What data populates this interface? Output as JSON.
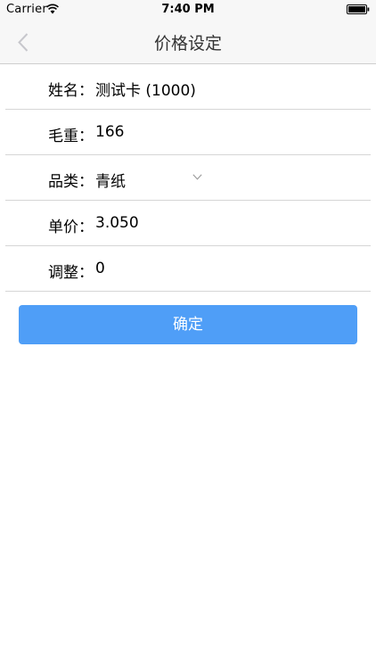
{
  "status_bar": {
    "carrier": "Carrier",
    "time": "7:40 PM",
    "wifi_icon": "wifi-icon",
    "battery_icon": "battery-icon"
  },
  "nav": {
    "title": "价格设定",
    "back_icon": "chevron-left-icon"
  },
  "form": {
    "rows": [
      {
        "label": "姓名：",
        "value": "测试卡 (1000)"
      },
      {
        "label": "毛重：",
        "value": "166"
      },
      {
        "label": "品类：",
        "value": "青纸",
        "dropdown_icon": "chevron-down-icon"
      },
      {
        "label": "单价：",
        "value": "3.050"
      },
      {
        "label": "调整：",
        "value": "0"
      }
    ]
  },
  "confirm_button": {
    "label": "确定",
    "color": "#4f9ef7"
  },
  "colors": {
    "bar_background": "#f7f7f7",
    "divider": "#d6d6d6",
    "back_chevron": "#c7c7cc"
  }
}
